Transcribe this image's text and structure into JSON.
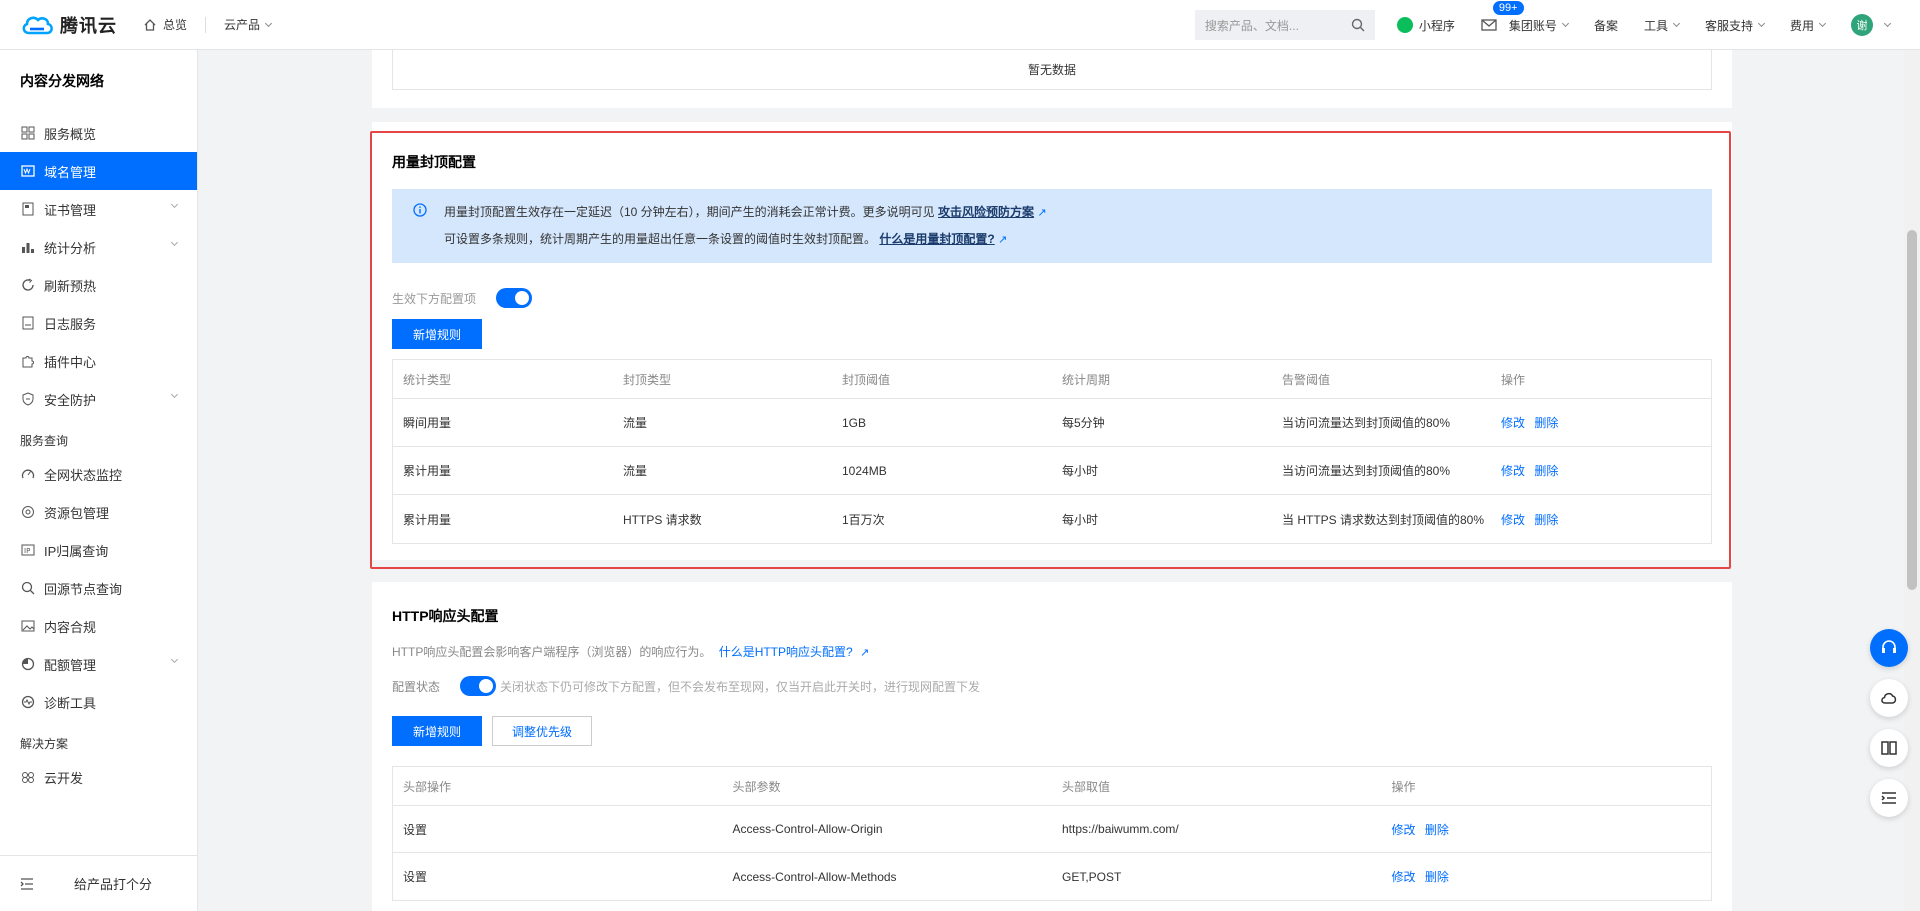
{
  "topnav": {
    "brand": "腾讯云",
    "home": "总览",
    "products": "云产品",
    "search_placeholder": "搜索产品、文档...",
    "mini_program": "小程序",
    "message_badge": "99+",
    "group_account": "集团账号",
    "beian": "备案",
    "tools": "工具",
    "support": "客服支持",
    "billing": "费用",
    "avatar_text": "谢"
  },
  "sidebar": {
    "title": "内容分发网络",
    "items": [
      {
        "label": "服务概览",
        "icon": "grid-icon"
      },
      {
        "label": "域名管理",
        "icon": "domain-icon"
      },
      {
        "label": "证书管理",
        "icon": "certificate-icon"
      },
      {
        "label": "统计分析",
        "icon": "chart-icon"
      },
      {
        "label": "刷新预热",
        "icon": "refresh-icon"
      },
      {
        "label": "日志服务",
        "icon": "log-icon"
      },
      {
        "label": "插件中心",
        "icon": "plugin-icon"
      },
      {
        "label": "安全防护",
        "icon": "shield-icon"
      }
    ],
    "group_service": "服务查询",
    "service_items": [
      {
        "label": "全网状态监控",
        "icon": "monitor-icon"
      },
      {
        "label": "资源包管理",
        "icon": "package-icon"
      },
      {
        "label": "IP归属查询",
        "icon": "ip-icon"
      },
      {
        "label": "回源节点查询",
        "icon": "search-node-icon"
      },
      {
        "label": "内容合规",
        "icon": "image-icon"
      },
      {
        "label": "配额管理",
        "icon": "quota-icon"
      },
      {
        "label": "诊断工具",
        "icon": "diagnose-icon"
      }
    ],
    "group_solution": "解决方案",
    "solution_items": [
      {
        "label": "云开发",
        "icon": "cloud-dev-icon"
      }
    ],
    "footer_rate": "给产品打个分"
  },
  "top_panel": {
    "empty_text": "暂无数据"
  },
  "usage_cap": {
    "title": "用量封顶配置",
    "info_line1_prefix": "用量封顶配置生效存在一定延迟（10 分钟左右），期间产生的消耗会正常计费。更多说明可见",
    "info_line1_link": "攻击风险预防方案",
    "info_line2_prefix": "可设置多条规则，统计周期产生的用量超出任意一条设置的阈值时生效封顶配置。",
    "info_line2_link": "什么是用量封顶配置?",
    "toggle_label": "生效下方配置项",
    "add_rule": "新增规则",
    "headers": [
      "统计类型",
      "封顶类型",
      "封顶阈值",
      "统计周期",
      "告警阈值",
      "操作"
    ],
    "rows": [
      {
        "type": "瞬间用量",
        "cap_type": "流量",
        "threshold": "1GB",
        "period": "每5分钟",
        "alert": "当访问流量达到封顶阈值的80%"
      },
      {
        "type": "累计用量",
        "cap_type": "流量",
        "threshold": "1024MB",
        "period": "每小时",
        "alert": "当访问流量达到封顶阈值的80%"
      },
      {
        "type": "累计用量",
        "cap_type": "HTTPS 请求数",
        "threshold": "1百万次",
        "period": "每小时",
        "alert": "当 HTTPS 请求数达到封顶阈值的80%"
      }
    ],
    "edit": "修改",
    "delete": "删除"
  },
  "http_header": {
    "title": "HTTP响应头配置",
    "desc": "HTTP响应头配置会影响客户端程序（浏览器）的响应行为。",
    "desc_link": "什么是HTTP响应头配置?",
    "status_label": "配置状态",
    "status_hint": "关闭状态下仍可修改下方配置，但不会发布至现网，仅当开启此开关时，进行现网配置下发",
    "add_rule": "新增规则",
    "adjust_priority": "调整优先级",
    "headers": [
      "头部操作",
      "头部参数",
      "头部取值",
      "操作"
    ],
    "rows": [
      {
        "op": "设置",
        "param": "Access-Control-Allow-Origin",
        "value": "https://baiwumm.com/"
      },
      {
        "op": "设置",
        "param": "Access-Control-Allow-Methods",
        "value": "GET,POST"
      }
    ],
    "edit": "修改",
    "delete": "删除"
  },
  "colors": {
    "primary": "#006eff",
    "highlight_border": "#e54545",
    "info_bg": "#d5e7fd"
  }
}
